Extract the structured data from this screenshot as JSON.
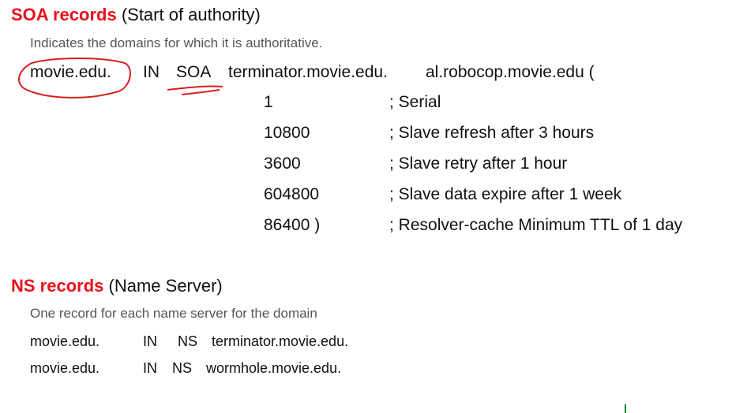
{
  "soa": {
    "title": "SOA records",
    "subtitle": "(Start of authority)",
    "description": "Indicates the domains for which it is authoritative.",
    "domain": "movie.edu.",
    "class": "IN",
    "type": "SOA",
    "primary_ns": "terminator.movie.edu.",
    "contact": "al.robocop.movie.edu (",
    "fields": [
      {
        "value": "1",
        "comment": "; Serial"
      },
      {
        "value": "10800",
        "comment": "; Slave refresh after 3 hours"
      },
      {
        "value": "3600",
        "comment": "; Slave retry after 1 hour"
      },
      {
        "value": "604800",
        "comment": "; Slave data expire after 1 week"
      },
      {
        "value": "86400 )",
        "comment": "; Resolver-cache Minimum TTL of 1 day"
      }
    ]
  },
  "ns": {
    "title": "NS records",
    "subtitle": "(Name Server)",
    "description": "One record for each name server for the domain",
    "records": [
      {
        "domain": "movie.edu.",
        "class": "IN",
        "type": "NS",
        "server": "terminator.movie.edu."
      },
      {
        "domain": "movie.edu.",
        "class": "IN",
        "type": "NS",
        "server": "wormhole.movie.edu."
      }
    ]
  },
  "annotation_color": "#d42020"
}
